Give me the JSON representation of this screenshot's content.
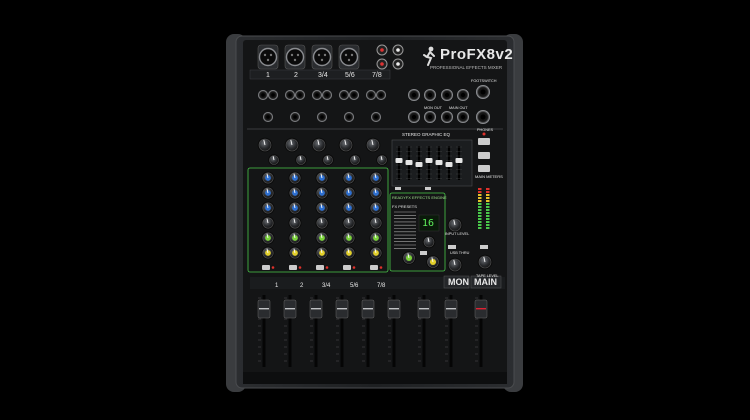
{
  "product": {
    "brand_logo": "mackie-running-man-logo",
    "model": "ProFX8v2",
    "tagline": "PROFESSIONAL EFFECTS MIXER"
  },
  "channel_numbers": [
    "1",
    "2",
    "3/4",
    "5/6",
    "7/8"
  ],
  "fader_labels": [
    "1",
    "2",
    "3/4",
    "5/6",
    "7/8",
    "MON",
    "MAIN"
  ],
  "sections": {
    "eq_title": "STEREO GRAPHIC EQ",
    "fx_engine": "READYFX EFFECTS ENGINE",
    "fx_presets": "FX PRESETS",
    "main_meters": "MAIN METERS",
    "outputs": [
      "MON OUT",
      "MAIN OUT",
      "PHONES",
      "FOOTSWITCH"
    ],
    "input_level": "INPUT LEVEL",
    "usb_thru": "USB THRU",
    "tape_level": "TAPE LEVEL"
  },
  "fx_display": "16",
  "colors": {
    "background": "#000000",
    "chassis": "#232527",
    "panel": "#141516",
    "knob_blue": "#2d6fd1",
    "knob_green": "#7bd23a",
    "knob_yellow": "#e2cf2a",
    "accent_green": "#49c84a",
    "led_red": "#e0312b"
  }
}
